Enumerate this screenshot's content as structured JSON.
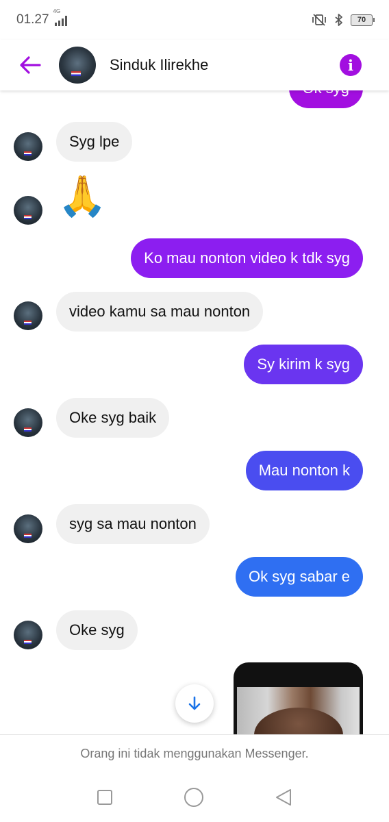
{
  "status_bar": {
    "time": "01.27",
    "network": "4G",
    "battery": "70"
  },
  "header": {
    "contact_name": "Sinduk Ilirekhe",
    "back_icon": "arrow-left-icon",
    "info_icon": "info-icon",
    "accent_color": "#a20fe0"
  },
  "messages": [
    {
      "direction": "outgoing",
      "text": "Ok syg",
      "color": "#a20fe0"
    },
    {
      "direction": "incoming",
      "text": "Syg lpe"
    },
    {
      "direction": "incoming",
      "text": "🙏"
    },
    {
      "direction": "outgoing",
      "text": "Ko mau nonton video k tdk syg",
      "color": "#8c1ef0"
    },
    {
      "direction": "incoming",
      "text": "video kamu sa mau nonton"
    },
    {
      "direction": "outgoing",
      "text": "Sy kirim k syg",
      "color": "#6a35f0"
    },
    {
      "direction": "incoming",
      "text": "Oke syg baik"
    },
    {
      "direction": "outgoing",
      "text": "Mau nonton k",
      "color": "#4a4df0"
    },
    {
      "direction": "incoming",
      "text": "syg sa mau nonton"
    },
    {
      "direction": "outgoing",
      "text": "Ok syg sabar e",
      "color": "#2f6ff2"
    },
    {
      "direction": "incoming",
      "text": "Oke syg"
    }
  ],
  "scroll_button_icon": "arrow-down-icon",
  "footer": {
    "notice": "Orang ini tidak menggunakan Messenger."
  },
  "nav_bar": {
    "icons": [
      "recents-square-icon",
      "home-circle-icon",
      "back-triangle-icon"
    ]
  }
}
